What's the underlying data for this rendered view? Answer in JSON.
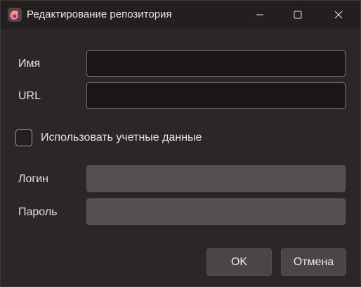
{
  "window": {
    "title": "Редактирование репозитория",
    "controls": [
      "minimize-icon",
      "maximize-icon",
      "close-icon"
    ]
  },
  "form": {
    "name_label": "Имя",
    "name_value": "",
    "url_label": "URL",
    "url_value": "",
    "use_credentials_label": "Использовать учетные данные",
    "use_credentials_checked": false,
    "login_label": "Логин",
    "login_value": "",
    "password_label": "Пароль",
    "password_value": ""
  },
  "buttons": {
    "ok_label": "OK",
    "cancel_label": "Отмена"
  },
  "colors": {
    "window_bg": "#2b2726",
    "titlebar_bg": "#231f1f",
    "input_active_bg": "#181616",
    "input_disabled_bg": "#545050",
    "button_bg": "#4b4646",
    "text": "#e4e1e1"
  }
}
